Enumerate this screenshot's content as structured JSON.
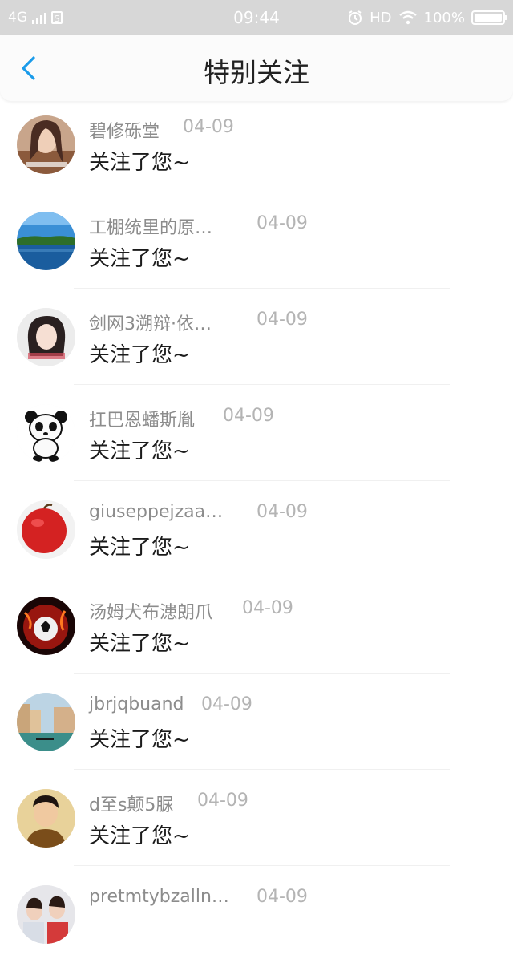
{
  "status_bar": {
    "network": "4G",
    "time": "09:44",
    "hd": "HD",
    "battery_text": "100%",
    "battery_level": 1.0
  },
  "header": {
    "title": "特别关注"
  },
  "items": [
    {
      "name": "碧修砾堂",
      "date": "04-09",
      "message": "关注了您~"
    },
    {
      "name": "工棚统里的原…",
      "date": "04-09",
      "message": "关注了您~"
    },
    {
      "name": "剑网3溯辩·依…",
      "date": "04-09",
      "message": "关注了您~"
    },
    {
      "name": "扛巴恩蟠斯胤",
      "date": "04-09",
      "message": "关注了您~"
    },
    {
      "name": "giuseppejzaa…",
      "date": "04-09",
      "message": "关注了您~"
    },
    {
      "name": "汤姆犬布漶朗爪",
      "date": "04-09",
      "message": "关注了您~"
    },
    {
      "name": "jbrjqbuand",
      "date": "04-09",
      "message": "关注了您~"
    },
    {
      "name": "d至s颠5脲",
      "date": "04-09",
      "message": "关注了您~"
    },
    {
      "name": "pretmtybzalln…",
      "date": "04-09",
      "message": ""
    }
  ],
  "colors": {
    "accent": "#1a9bea",
    "status_bar_bg": "#d7d7d7"
  }
}
